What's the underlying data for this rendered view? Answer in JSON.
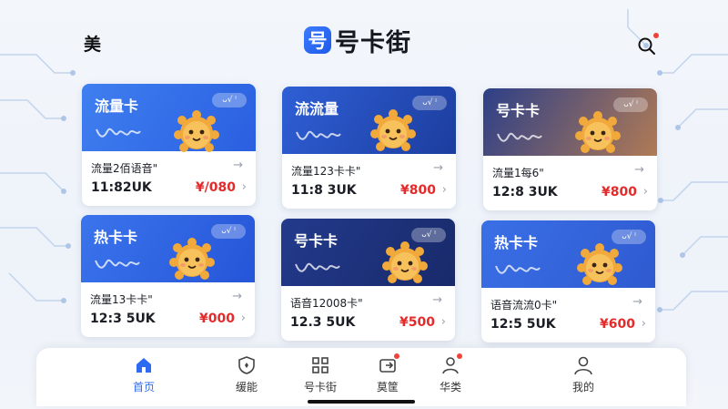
{
  "header": {
    "region": "美",
    "brand_logo_char": "号",
    "brand_name": "号卡街",
    "search_icon": "search-icon"
  },
  "cards": [
    {
      "title": "流量卡",
      "tag": "ᴗ√ ˡ",
      "plan": "流量2佰语音\"",
      "detail": "11:82UK",
      "price": "¥/080",
      "theme": "#3f7ff0",
      "theme2": "#2a5fe0"
    },
    {
      "title": "流流量",
      "tag": "ᴗ√ ˡ",
      "plan": "流量123卡卡\"",
      "detail": "11:8 3UK",
      "price": "¥800",
      "theme": "#2f5fd6",
      "theme2": "#1c3d9e"
    },
    {
      "title": "号卡卡",
      "tag": "ᴗ√ ˡ",
      "plan": "流量1每6\"",
      "detail": "12:8 3UK",
      "price": "¥800",
      "theme": "#2d3f88",
      "theme2": "#b07a55"
    },
    {
      "title": "热卡卡",
      "tag": "ᴗ√ ˡ",
      "plan": "流量13卡卡\"",
      "detail": "12:3 5UK",
      "price": "¥000",
      "theme": "#3b74ec",
      "theme2": "#2555d8"
    },
    {
      "title": "号卡卡",
      "tag": "ᴗ√ ˡ",
      "plan": "语音12008卡\"",
      "detail": "12.3 5UK",
      "price": "¥500",
      "theme": "#233a8c",
      "theme2": "#182a6a"
    },
    {
      "title": "热卡卡",
      "tag": "ᴗ√ ˡ",
      "plan": "语音流流0卡\"",
      "detail": "12:5 5UK",
      "price": "¥600",
      "theme": "#3a6fe6",
      "theme2": "#2f5ad0"
    }
  ],
  "nav": [
    {
      "label": "首页",
      "icon": "home-icon",
      "active": true,
      "dot": false
    },
    {
      "label": "缓能",
      "icon": "shield-icon",
      "active": false,
      "dot": false
    },
    {
      "label": "号卡街",
      "icon": "grid-icon",
      "active": false,
      "dot": false
    },
    {
      "label": "莫筐",
      "icon": "export-icon",
      "active": false,
      "dot": true
    },
    {
      "label": "华类",
      "icon": "user-icon",
      "active": false,
      "dot": true
    },
    {
      "label": "我的",
      "icon": "profile-icon",
      "active": false,
      "dot": false
    }
  ],
  "colors": {
    "accent": "#2d6cf0",
    "price": "#e42b2b"
  }
}
